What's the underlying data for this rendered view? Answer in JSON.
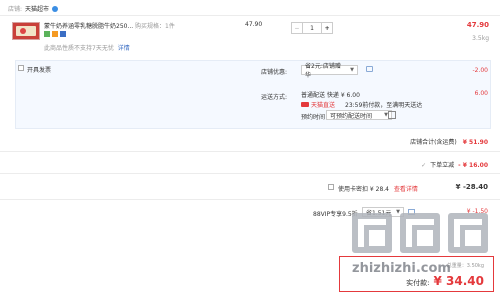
{
  "store": {
    "label": "店铺:",
    "name": "天猫超市"
  },
  "product": {
    "title": "蒙牛奶养涵零乳糖脱脂牛奶250...",
    "spec": "购买规格：1件",
    "no_return_note": "此商品性质不支持7天无忧",
    "detail_link": "详情",
    "unit_price": "47.90",
    "quantity": "1",
    "subtotal": "47.90",
    "weight": "3.5kg"
  },
  "invoice": {
    "label": "开具发票"
  },
  "promo": {
    "label": "店铺优惠:",
    "selected": "省2元:店铺赠华",
    "amount": "-2.00"
  },
  "delivery": {
    "label": "运送方式:",
    "option": "普通配送 快递 ¥ 6.00",
    "tmall_tag": "天猫直送",
    "eta": "23:59前付款，至满明天送达",
    "time_label": "预约时间",
    "time_selected": "可预约配送时间",
    "amount": "6.00"
  },
  "store_total": {
    "label": "店铺合计(含运费)",
    "value": "¥ 51.90"
  },
  "discount": {
    "label": "下单立减",
    "value": "- ¥ 16.00"
  },
  "coupon": {
    "text": "使用卡密扣 ¥ 28.4",
    "link": "查看详情",
    "value": "¥ -28.40"
  },
  "vip": {
    "label": "88VIP专享9.5折",
    "selected": "省1.51元",
    "value": "¥ -1.50"
  },
  "payment": {
    "weight_label": "总重量：",
    "weight_value": "3.50kg",
    "label": "实付款:",
    "value": "¥ 34.40"
  },
  "watermark": {
    "text": "zhizhizhi.com"
  },
  "colors": {
    "price_red": "#e4393c",
    "link_blue": "#3b6ec4",
    "panel_bg": "#f5f9ff",
    "tmall_red": "#e4393c"
  }
}
